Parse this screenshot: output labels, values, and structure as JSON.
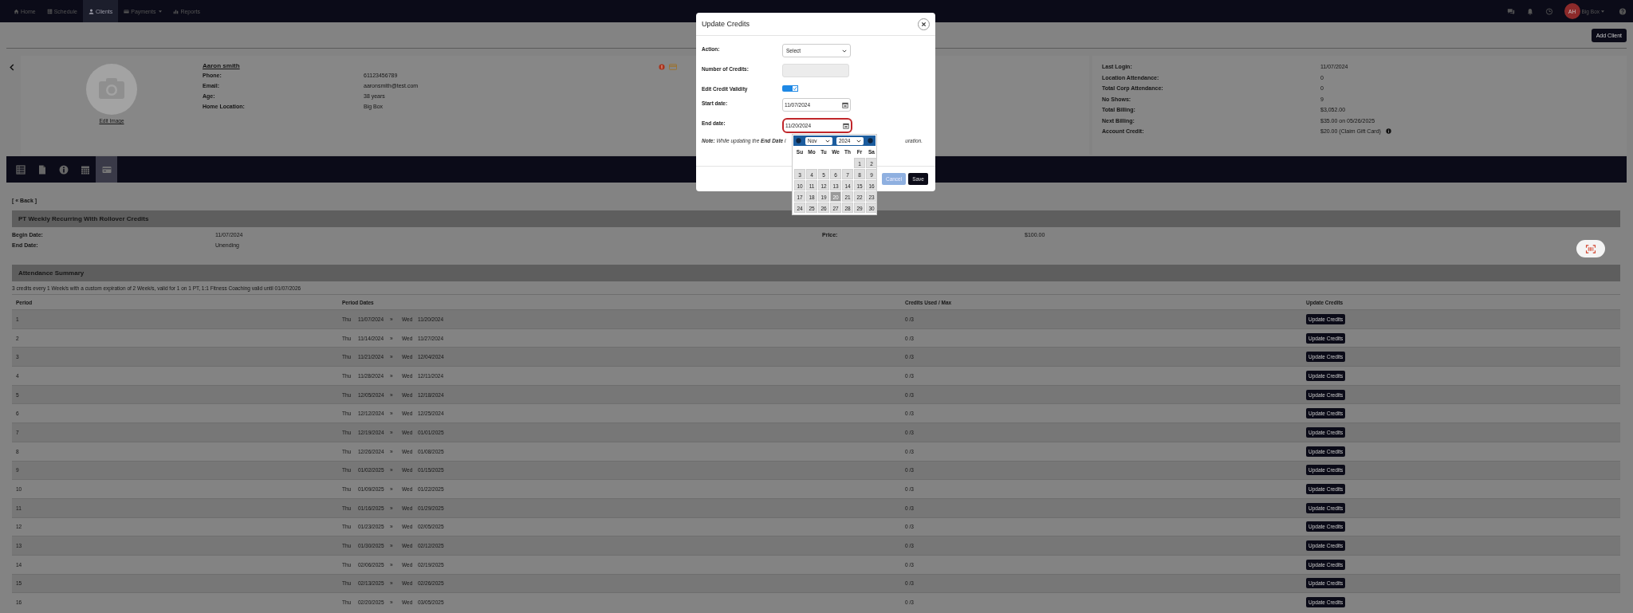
{
  "nav": {
    "items": [
      {
        "label": "Home",
        "kind": "home",
        "has_menu": false,
        "selected": false
      },
      {
        "label": "Schedule",
        "kind": "schedule",
        "has_menu": false,
        "selected": false
      },
      {
        "label": "Clients",
        "kind": "clients",
        "has_menu": false,
        "selected": true
      },
      {
        "label": "Payments",
        "kind": "payments",
        "has_menu": true,
        "selected": false
      },
      {
        "label": "Reports",
        "kind": "reports",
        "has_menu": false,
        "selected": false
      }
    ],
    "user": {
      "initials": "AH",
      "location": "Big Box"
    }
  },
  "header": {
    "add_button": "Add Client"
  },
  "profile": {
    "edit_image": "Edit Image",
    "name": "Aaron smith",
    "fields": [
      {
        "label": "Phone:",
        "value": "61123456789"
      },
      {
        "label": "Email:",
        "value": "aaronsmith@test.com"
      },
      {
        "label": "Age:",
        "value": "38 years"
      },
      {
        "label": "Home Location:",
        "value": "Big Box"
      }
    ]
  },
  "stats": [
    {
      "label": "Last Login:",
      "value": "11/07/2024"
    },
    {
      "label": "Location Attendance:",
      "value": "0"
    },
    {
      "label": "Total Corp Attendance:",
      "value": "0"
    },
    {
      "label": "No Shows:",
      "value": "9"
    },
    {
      "label": "Total Billing:",
      "value": "$3,052.00"
    },
    {
      "label": "Next Billing:",
      "value": "$35.00 on 05/26/2025"
    },
    {
      "label": "Account Credit:",
      "value": "$20.00 (Claim Gift Card)",
      "info": true
    }
  ],
  "toolbar_tabs": [
    {
      "kind": "list",
      "selected": false
    },
    {
      "kind": "document",
      "selected": false
    },
    {
      "kind": "info",
      "selected": false
    },
    {
      "kind": "calendar",
      "selected": false
    },
    {
      "kind": "card",
      "selected": true
    }
  ],
  "back_link": "[ « Back ]",
  "package": {
    "title": "PT Weekly Recurring With Rollover Credits",
    "fields": [
      {
        "label": "Begin Date:",
        "value": "11/07/2024"
      },
      {
        "label": "End Date:",
        "value": "Unending"
      }
    ],
    "price": {
      "label": "Price:",
      "value": "$100.00"
    }
  },
  "attendance": {
    "title": "Attendance Summary",
    "description": "3 credits every 1 Week/s with a custom expiration of 2 Week/s, valid for 1 on 1 PT, 1:1 Fitness Coaching valid until 01/07/2026",
    "columns": [
      "Period",
      "Period Dates",
      "Credits Used / Max",
      "Update Credits"
    ],
    "rows": [
      {
        "period": "1",
        "start_day": "Thu",
        "start_date": "11/07/2024",
        "separator": "»",
        "end_day": "Wed",
        "end_date": "11/20/2024",
        "credits": "0 /3",
        "button": "Update Credits"
      },
      {
        "period": "2",
        "start_day": "Thu",
        "start_date": "11/14/2024",
        "separator": "»",
        "end_day": "Wed",
        "end_date": "11/27/2024",
        "credits": "0 /3",
        "button": "Update Credits"
      },
      {
        "period": "3",
        "start_day": "Thu",
        "start_date": "11/21/2024",
        "separator": "»",
        "end_day": "Wed",
        "end_date": "12/04/2024",
        "credits": "0 /3",
        "button": "Update Credits"
      },
      {
        "period": "4",
        "start_day": "Thu",
        "start_date": "11/28/2024",
        "separator": "»",
        "end_day": "Wed",
        "end_date": "12/11/2024",
        "credits": "0 /3",
        "button": "Update Credits"
      },
      {
        "period": "5",
        "start_day": "Thu",
        "start_date": "12/05/2024",
        "separator": "»",
        "end_day": "Wed",
        "end_date": "12/18/2024",
        "credits": "0 /3",
        "button": "Update Credits"
      },
      {
        "period": "6",
        "start_day": "Thu",
        "start_date": "12/12/2024",
        "separator": "»",
        "end_day": "Wed",
        "end_date": "12/25/2024",
        "credits": "0 /3",
        "button": "Update Credits"
      },
      {
        "period": "7",
        "start_day": "Thu",
        "start_date": "12/19/2024",
        "separator": "»",
        "end_day": "Wed",
        "end_date": "01/01/2025",
        "credits": "0 /3",
        "button": "Update Credits"
      },
      {
        "period": "8",
        "start_day": "Thu",
        "start_date": "12/26/2024",
        "separator": "»",
        "end_day": "Wed",
        "end_date": "01/08/2025",
        "credits": "0 /3",
        "button": "Update Credits"
      },
      {
        "period": "9",
        "start_day": "Thu",
        "start_date": "01/02/2025",
        "separator": "»",
        "end_day": "Wed",
        "end_date": "01/15/2025",
        "credits": "0 /3",
        "button": "Update Credits"
      },
      {
        "period": "10",
        "start_day": "Thu",
        "start_date": "01/09/2025",
        "separator": "»",
        "end_day": "Wed",
        "end_date": "01/22/2025",
        "credits": "0 /3",
        "button": "Update Credits"
      },
      {
        "period": "11",
        "start_day": "Thu",
        "start_date": "01/16/2025",
        "separator": "»",
        "end_day": "Wed",
        "end_date": "01/29/2025",
        "credits": "0 /3",
        "button": "Update Credits"
      },
      {
        "period": "12",
        "start_day": "Thu",
        "start_date": "01/23/2025",
        "separator": "»",
        "end_day": "Wed",
        "end_date": "02/05/2025",
        "credits": "0 /3",
        "button": "Update Credits"
      },
      {
        "period": "13",
        "start_day": "Thu",
        "start_date": "01/30/2025",
        "separator": "»",
        "end_day": "Wed",
        "end_date": "02/12/2025",
        "credits": "0 /3",
        "button": "Update Credits"
      },
      {
        "period": "14",
        "start_day": "Thu",
        "start_date": "02/06/2025",
        "separator": "»",
        "end_day": "Wed",
        "end_date": "02/19/2025",
        "credits": "0 /3",
        "button": "Update Credits"
      },
      {
        "period": "15",
        "start_day": "Thu",
        "start_date": "02/13/2025",
        "separator": "»",
        "end_day": "Wed",
        "end_date": "02/26/2025",
        "credits": "0 /3",
        "button": "Update Credits"
      },
      {
        "period": "16",
        "start_day": "Thu",
        "start_date": "02/20/2025",
        "separator": "»",
        "end_day": "Wed",
        "end_date": "03/05/2025",
        "credits": "0 /3",
        "button": "Update Credits"
      }
    ]
  },
  "modal": {
    "title": "Update Credits",
    "action": {
      "label": "Action:",
      "value": "Select"
    },
    "credits": {
      "label": "Number of Credits:"
    },
    "credit_validity": {
      "label": "Edit Credit Validity",
      "on": true
    },
    "start_date": {
      "label": "Start date:",
      "value": "11/07/2024",
      "highlighted": false
    },
    "end_date": {
      "label": "End date:",
      "value": "11/20/2024",
      "highlighted": true
    },
    "note_start": "**Note:** While updating the **End Date** i",
    "note_end": "uration.",
    "cancel": "Cancel",
    "save": "Save",
    "calendar": {
      "month": "Nov",
      "year": "2024",
      "weekdays": [
        "Su",
        "Mo",
        "Tu",
        "We",
        "Th",
        "Fr",
        "Sa"
      ],
      "weeks": [
        [
          {
            "day": "1",
            "selected": false
          },
          {
            "day": "2",
            "selected": false
          }
        ],
        [
          {
            "day": "3",
            "selected": false
          },
          {
            "day": "4",
            "selected": false
          },
          {
            "day": "5",
            "selected": false
          },
          {
            "day": "6",
            "selected": false
          },
          {
            "day": "7",
            "selected": false
          },
          {
            "day": "8",
            "selected": false
          },
          {
            "day": "9",
            "selected": false
          }
        ],
        [
          {
            "day": "10",
            "selected": false
          },
          {
            "day": "11",
            "selected": false
          },
          {
            "day": "12",
            "selected": false
          },
          {
            "day": "13",
            "selected": false
          },
          {
            "day": "14",
            "selected": false
          },
          {
            "day": "15",
            "selected": false
          },
          {
            "day": "16",
            "selected": false
          }
        ],
        [
          {
            "day": "17",
            "selected": false
          },
          {
            "day": "18",
            "selected": false
          },
          {
            "day": "19",
            "selected": false
          },
          {
            "day": "20",
            "selected": true
          },
          {
            "day": "21",
            "selected": false
          },
          {
            "day": "22",
            "selected": false
          },
          {
            "day": "23",
            "selected": false
          }
        ],
        [
          {
            "day": "24",
            "selected": false
          },
          {
            "day": "25",
            "selected": false
          },
          {
            "day": "26",
            "selected": false
          },
          {
            "day": "27",
            "selected": false
          },
          {
            "day": "28",
            "selected": false
          },
          {
            "day": "29",
            "selected": false
          },
          {
            "day": "30",
            "selected": false
          }
        ]
      ]
    }
  }
}
